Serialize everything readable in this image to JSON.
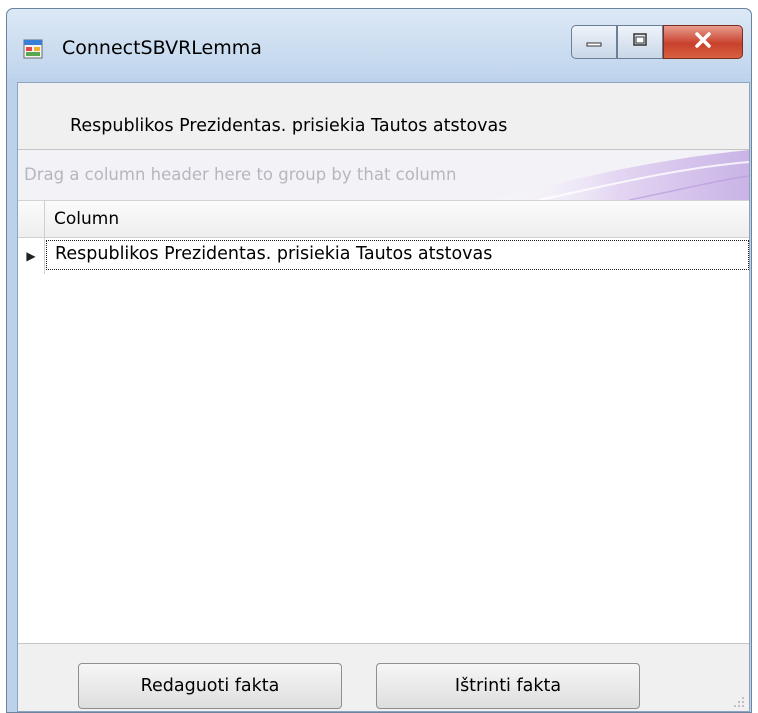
{
  "window": {
    "title": "ConnectSBVRLemma",
    "icon": "app-form-icon",
    "controls": [
      "minimize-icon",
      "maximize-icon",
      "close-icon"
    ]
  },
  "content": {
    "header_label": "Respublikos Prezidentas. prisiekia Tautos atstovas"
  },
  "grid": {
    "group_panel_text": "Drag a column header here to group by that column",
    "columns": [
      "Column"
    ],
    "rows": [
      [
        "Respublikos Prezidentas. prisiekia Tautos atstovas"
      ]
    ]
  },
  "buttons": {
    "edit_label": "Redaguoti fakta",
    "delete_label": "Ištrinti fakta"
  },
  "colors": {
    "titlebar": "#bfd4ec",
    "close_button": "#c8412c",
    "client": "#f0f0f0"
  }
}
